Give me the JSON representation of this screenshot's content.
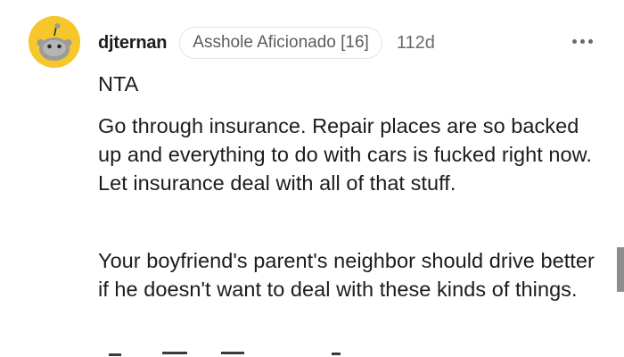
{
  "comment": {
    "username": "djternan",
    "flair": "Asshole Aficionado [16]",
    "age": "112d",
    "verdict": "NTA",
    "paragraphs": [
      "Go through insurance. Repair places are so backed up and everything to do with cars is fucked right now. Let insurance deal with all of that stuff.",
      "Your boyfriend's parent's neighbor should drive better if he doesn't want to deal with these kinds of things."
    ]
  },
  "icons": {
    "avatar": "snoo-avatar-icon",
    "more": "more-options-icon"
  },
  "colors": {
    "avatar_bg": "#f5c72a",
    "text": "#1c1c1c",
    "muted": "#6a6a6a",
    "flair_border": "#e4e4e4"
  }
}
